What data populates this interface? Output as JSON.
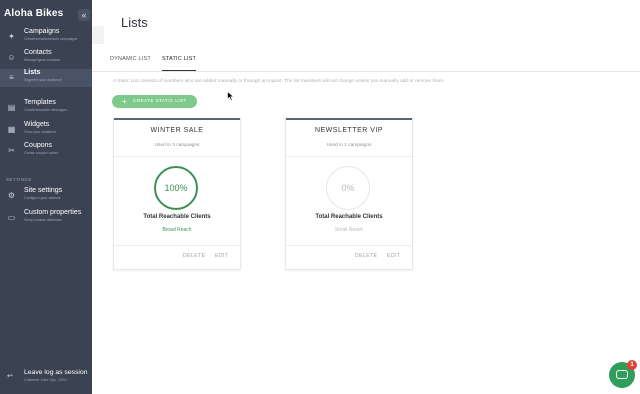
{
  "sidebar": {
    "brand": "Aloha Bikes",
    "collapse_icon": "«",
    "items": [
      {
        "label": "Campaigns",
        "sub": "Create/send/schedule campaigns",
        "icon": "campaigns-icon",
        "glyph": "✦"
      },
      {
        "label": "Contacts",
        "sub": "Manage/grow contacts",
        "icon": "contacts-icon",
        "glyph": "☺"
      },
      {
        "label": "Lists",
        "sub": "Segment your audience",
        "icon": "lists-icon",
        "glyph": "≡"
      },
      {
        "label": "Templates",
        "sub": "Create/reusable messages",
        "icon": "templates-icon",
        "glyph": "▤"
      },
      {
        "label": "Widgets",
        "sub": "Grow your audience",
        "icon": "widgets-icon",
        "glyph": "▦"
      },
      {
        "label": "Coupons",
        "sub": "Create coupon codes",
        "icon": "coupons-icon",
        "glyph": "✂"
      }
    ],
    "settings_label": "SETTINGS",
    "settings_items": [
      {
        "label": "Site settings",
        "sub": "Configure your website",
        "icon": "settings-icon",
        "glyph": "⚙"
      },
      {
        "label": "Custom properties",
        "sub": "Setup custom attributes",
        "icon": "properties-icon",
        "glyph": "▭"
      }
    ],
    "leave": {
      "label": "Leave log as session",
      "sub": "Customer Care Ops - 0001",
      "icon": "leave-icon",
      "glyph": "↩"
    }
  },
  "header": {
    "title": "Lists",
    "tabs": [
      {
        "label": "DYNAMIC LIST",
        "active": false
      },
      {
        "label": "STATIC LIST",
        "active": true
      }
    ]
  },
  "main": {
    "description": "A Static List consists of members who are added manually or through an import. The list members will not change unless you manually add or remove them.",
    "create_button": "CREATE STATIC LIST",
    "cards": [
      {
        "name": "WINTER SALE",
        "used": "Used in 3 campaigns",
        "percent": "100%",
        "reach_title": "Total Reachable Clients",
        "reach_level": "Broad Reach",
        "actions": [
          "DELETE",
          "EDIT"
        ]
      },
      {
        "name": "NEWSLETTER VIP",
        "used": "Used in 1 campaigns",
        "percent": "0%",
        "reach_title": "Total Reachable Clients",
        "reach_level": "Small Reach",
        "actions": [
          "DELETE",
          "EDIT"
        ]
      }
    ]
  },
  "chat": {
    "badge": "1"
  },
  "colors": {
    "sidebar_bg": "#3b4252",
    "accent_green": "#7fc98a",
    "ring_full": "#3f8f55",
    "ring_empty": "#e4e6e9",
    "chat_green": "#2f9e58",
    "badge_red": "#e0433a"
  }
}
